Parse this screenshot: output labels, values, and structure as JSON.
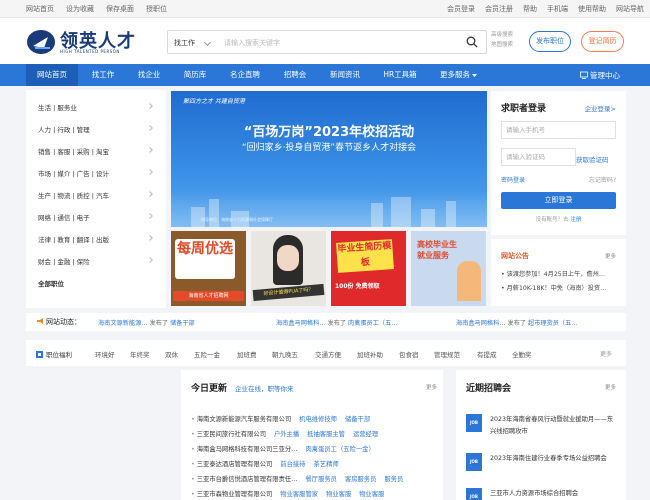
{
  "topbar": {
    "left": [
      "网站首页",
      "设为收藏",
      "保存桌面",
      "授职位"
    ],
    "right": [
      "会员登录",
      "会员注册",
      "帮助",
      "手机端",
      "使用帮助",
      "网站导航"
    ]
  },
  "header": {
    "logo_text": "领英人才",
    "logo_sub": "HIGH TALENTED PERSON",
    "search_select": "找工作",
    "search_placeholder": "请输入搜索关键字",
    "adv_search": "高级搜索",
    "map_search": "地图搜索",
    "publish_btn": "发布职位",
    "login_btn": "登记简历"
  },
  "nav": {
    "items": [
      "网站首页",
      "找工作",
      "找企业",
      "简历库",
      "名企直聘",
      "招聘会",
      "新闻资讯",
      "HR工具箱",
      "更多服务"
    ],
    "manage": "管理中心"
  },
  "categories": [
    "生活 | 服务业",
    "人力 | 行政 | 管理",
    "销售 | 客服 | 采购 | 淘宝",
    "市场 | 媒介 | 广告 | 设计",
    "生产 | 物流 | 质控 | 汽车",
    "网络 | 通信 | 电子",
    "法律 | 教育 | 翻译 | 出版",
    "财会 | 金融 | 保险",
    "全部职位"
  ],
  "banner": {
    "slogan": "聚四方之才  共建自贸港",
    "title": "“百场万岗”2023年校招活动",
    "subtitle": "“回归家乡·投身自贸港”春节返乡人才对接会",
    "footer": "指导单位：海南省人力资源和社会保障厅"
  },
  "ads": [
    {
      "text": "每周优选",
      "caption": "海南省人才招聘网"
    },
    {
      "text": "好设计值得PUA了吗？"
    },
    {
      "text": "毕业生简历模板",
      "caption": "100份 免费领取"
    },
    {
      "text": "高校毕业生就业服务"
    }
  ],
  "login": {
    "title": "求职者登录",
    "corp_login": "企业登录>",
    "phone_placeholder": "请输入手机号",
    "code_placeholder": "请输入验证码",
    "get_code": "获取验证码",
    "pwd_login": "密码登录",
    "forget": "忘记密码?",
    "submit": "立即登录",
    "no_account": "没有账号？去",
    "register": "注册"
  },
  "notice": {
    "title": "网站公告",
    "more": "更多",
    "items": [
      "• 该渡您参加！4月25日上午，儋州…",
      "• 月薪10K-18K！中免（海南）投资…"
    ]
  },
  "dynamics": {
    "label": "网站动态：",
    "items": [
      {
        "company": "海南文源新能源…",
        "action": "发布了",
        "job": "储备干部"
      },
      {
        "company": "海南盒马网格科…",
        "action": "发布了",
        "job": "肉禽蛋员工（五…"
      },
      {
        "company": "海南盒马网格科…",
        "action": "发布了",
        "job": "超市理货员（五…"
      }
    ]
  },
  "tags": {
    "label": "职位福利",
    "items": [
      "环境好",
      "年终奖",
      "双休",
      "五险一金",
      "加班费",
      "朝九晚五",
      "交通方便",
      "加班补助",
      "包食宿",
      "管理规范",
      "有提成",
      "全勤奖"
    ],
    "more": "更多"
  },
  "today": {
    "title": "今日更新",
    "subtitle": "企业在线，职等你来",
    "more": "更多",
    "rows": [
      {
        "company": "海南文源新能源汽车服务有限公司",
        "jobs": [
          "机电维修技师",
          "储备干部"
        ]
      },
      {
        "company": "三亚民间旅行社有限公司",
        "jobs": [
          "户外主播",
          "抵抽客服主管",
          "运营经理"
        ]
      },
      {
        "company": "海南盒马网格科技有限公司三亚分…",
        "jobs": [
          "肉禽蛋员工（五险一金）"
        ]
      },
      {
        "company": "三亚泰达酒店管理有限公司",
        "jobs": [
          "前台接待",
          "茶艺精师"
        ]
      },
      {
        "company": "三亚市台爵信悦酒店管理有限责任…",
        "jobs": [
          "餐厅服务员",
          "客房服务员",
          "服务员"
        ]
      },
      {
        "company": "三亚市森物业管理有限公司",
        "jobs": [
          "物业客服管家",
          "物业客服",
          "物业客服"
        ]
      }
    ]
  },
  "recent": {
    "title": "近期招聘会",
    "more": "更多",
    "items": [
      "2023年海南省春风行动暨就业援助月——东兴线招聘攻市",
      "2023年海南住建行业春季专场公益招聘会",
      "三亚市人力资源市场综合招聘会"
    ]
  }
}
